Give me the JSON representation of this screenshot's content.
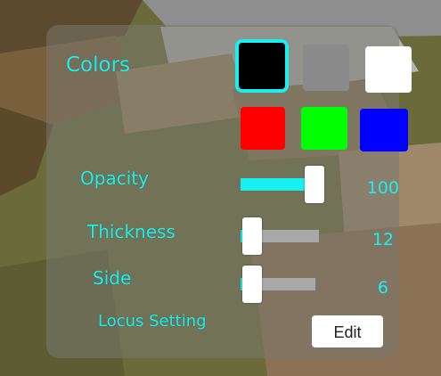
{
  "colors": {
    "title": "Colors",
    "swatches": [
      {
        "name": "black",
        "hex": "#000000",
        "selected": true
      },
      {
        "name": "gray",
        "hex": "#8a8a8a",
        "selected": false
      },
      {
        "name": "white",
        "hex": "#ffffff",
        "selected": false
      },
      {
        "name": "red",
        "hex": "#ff0000",
        "selected": false
      },
      {
        "name": "green",
        "hex": "#00ff00",
        "selected": false
      },
      {
        "name": "blue",
        "hex": "#0000ff",
        "selected": false
      }
    ],
    "accent": "#18f0f0"
  },
  "opacity": {
    "label": "Opacity",
    "value": "100",
    "fraction": 1.0
  },
  "thickness": {
    "label": "Thickness",
    "value": "12",
    "fraction": 0.12
  },
  "side": {
    "label": "Side",
    "value": "6",
    "fraction": 0.06
  },
  "locus": {
    "label": "Locus Setting",
    "button": "Edit"
  }
}
